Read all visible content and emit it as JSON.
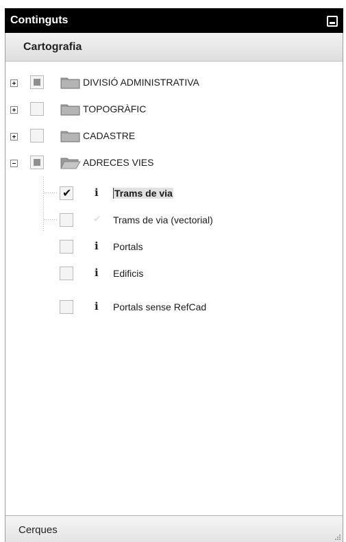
{
  "panel": {
    "title": "Continguts",
    "section": "Cartografia",
    "footer": "Cerques"
  },
  "colors": {
    "header_bg": "#000000",
    "folder_gray": "#9a9a9a",
    "selected_bg": "#e1e1e1"
  },
  "icons": {
    "collapse": "minimize-icon",
    "folder": "folder-icon",
    "folder_open": "folder-open-icon",
    "info": "info-icon",
    "check": "checkmark-icon",
    "grip": "resize-grip-icon"
  },
  "tree": {
    "folders": [
      {
        "label": "DIVISIÓ ADMINISTRATIVA",
        "expanded": false,
        "state": "partial"
      },
      {
        "label": "TOPOGRÀFIC",
        "expanded": false,
        "state": "unchecked"
      },
      {
        "label": "CADASTRE",
        "expanded": false,
        "state": "unchecked"
      },
      {
        "label": "ADRECES VIES",
        "expanded": true,
        "state": "partial"
      }
    ],
    "layers": [
      {
        "label": "Trams de via",
        "checked": true,
        "has_info": true,
        "selected": true
      },
      {
        "label": "Trams de via (vectorial)",
        "checked": false,
        "has_info": false,
        "selected": false
      },
      {
        "label": "Portals",
        "checked": false,
        "has_info": true,
        "selected": false
      },
      {
        "label": "Edificis",
        "checked": false,
        "has_info": true,
        "selected": false
      },
      {
        "label": "Portals sense RefCad",
        "checked": false,
        "has_info": true,
        "selected": false
      }
    ],
    "info_glyph": "i",
    "check_glyph": "✔"
  }
}
